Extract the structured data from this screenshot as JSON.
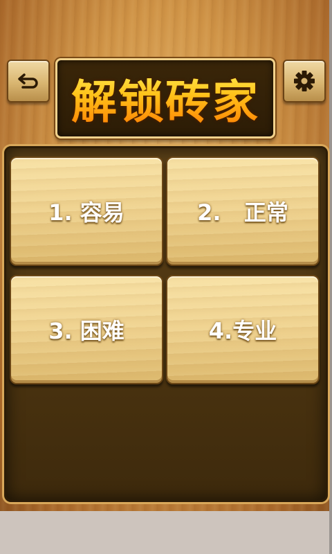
{
  "header": {
    "title": "解锁砖家",
    "back_icon": "undo-arrow-icon",
    "settings_icon": "gear-icon"
  },
  "levels": [
    {
      "label": "1. 容易"
    },
    {
      "label": "2.   正常"
    },
    {
      "label": "3. 困难"
    },
    {
      "label": "4.专业"
    }
  ],
  "colors": {
    "title_gradient_top": "#fff25a",
    "title_gradient_bottom": "#ff7a00",
    "board": "#4a3310",
    "button_wood": "#efd28f"
  }
}
